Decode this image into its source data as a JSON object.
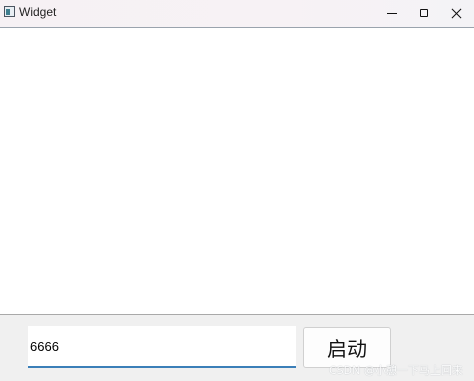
{
  "window": {
    "title": "Widget",
    "app_icon": "app-window-icon",
    "controls": {
      "minimize_icon": "minimize-icon",
      "maximize_icon": "maximize-icon",
      "close_icon": "close-icon"
    }
  },
  "bottom": {
    "input_value": "6666",
    "start_button_label": "启动"
  },
  "watermark": "CSDN @小憩一下马上回来",
  "colors": {
    "input_focus_underline": "#3b7fb8",
    "panel_background": "#f0f0f0"
  }
}
